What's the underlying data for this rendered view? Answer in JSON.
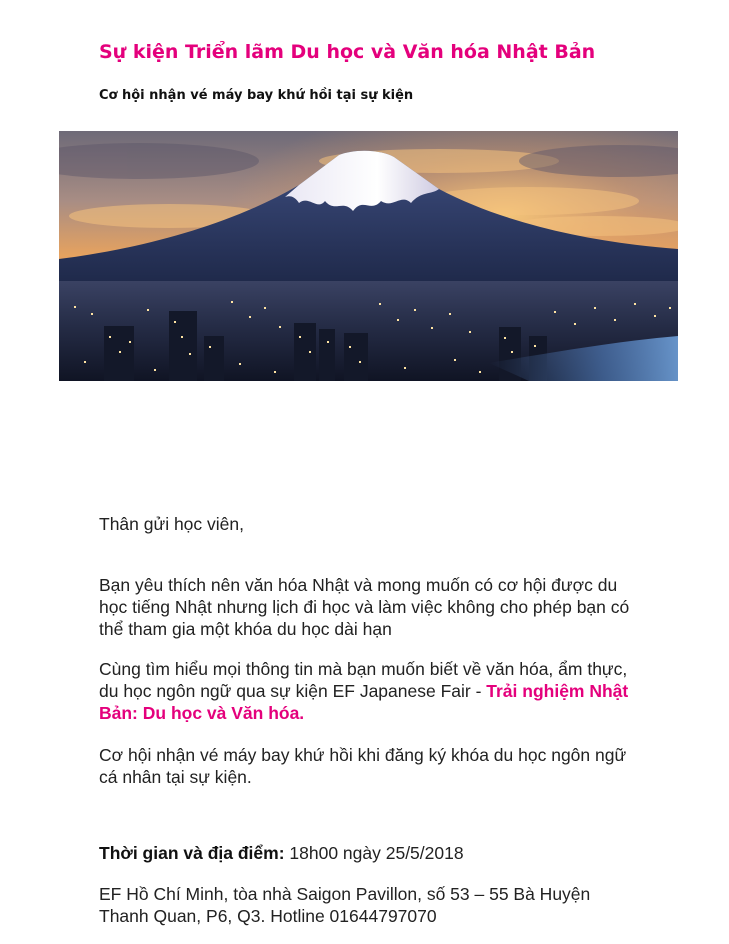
{
  "email": {
    "title": "Sự kiện Triển lãm Du học và Văn hóa Nhật Bản",
    "subtitle": "Cơ hội nhận vé máy bay khứ hồi tại sự kiện",
    "hero_image": "mount-fuji-city-skyline"
  },
  "body": {
    "greeting": "Thân gửi học viên,",
    "paragraph1": "Bạn yêu thích nên văn hóa Nhật và mong muốn có cơ hội được du học tiếng Nhật nhưng lịch đi học và làm việc không cho phép bạn có thể tham gia một khóa du học dài hạn",
    "paragraph2_prefix": "Cùng tìm hiểu mọi thông tin mà bạn muốn biết về văn hóa, ẩm thực, du học ngôn ngữ qua sự kiện EF Japanese Fair - ",
    "paragraph2_highlight": "Trải nghiệm Nhật Bản: Du học và Văn hóa.",
    "paragraph3": "Cơ hội nhận vé máy bay khứ hồi khi đăng ký khóa du học ngôn ngữ cá nhân tại sự kiện.",
    "time_label": "Thời gian và địa điểm:",
    "time_value": " 18h00 ngày 25/5/2018",
    "address": "EF Hồ Chí Minh, tòa nhà Saigon Pavillon, số 53 – 55 Bà Huyện Thanh Quan, P6, Q3. Hotline 01644797070"
  },
  "colors": {
    "accent": "#e4007c",
    "text": "#222222"
  }
}
